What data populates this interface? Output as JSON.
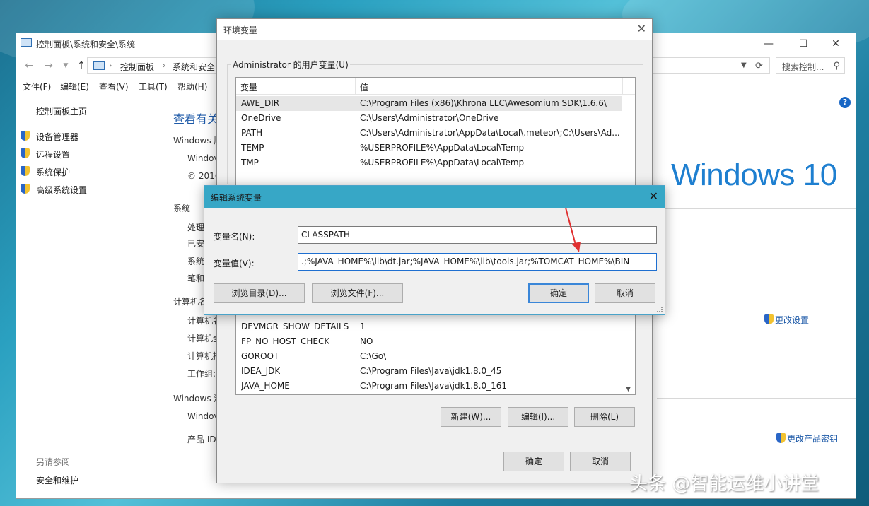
{
  "control_panel": {
    "title": "控制面板\\系统和安全\\系统",
    "breadcrumbs": [
      "控制面板",
      "系统和安全"
    ],
    "search_placeholder": "搜索控制...",
    "menu": [
      "文件(F)",
      "编辑(E)",
      "查看(V)",
      "工具(T)",
      "帮助(H)"
    ],
    "left_home": "控制面板主页",
    "left_links": [
      "设备管理器",
      "远程设置",
      "系统保护",
      "高级系统设置"
    ],
    "see_also": "另请参阅",
    "see_also_link": "安全和维护",
    "heading": "查看有关",
    "sections": {
      "windows_edition": "Windows 版",
      "edition_lines": [
        "Windov",
        "© 2016"
      ],
      "system": "系统",
      "system_lines": [
        "处理",
        "已安",
        "系统",
        "笔和"
      ],
      "computer": "计算机名",
      "computer_lines": [
        "计算机名",
        "计算机全",
        "计算机描",
        "工作组:"
      ],
      "activation": "Windows 激",
      "activation_lines": [
        "Windov",
        "产品 ID:"
      ]
    },
    "logo": "Windows 10",
    "change_settings": "更改设置",
    "change_key": "更改产品密钥"
  },
  "env_dialog": {
    "title": "环境变量",
    "user_group_label": "Administrator 的用户变量(U)",
    "col_var": "变量",
    "col_val": "值",
    "user_vars": [
      {
        "name": "AWE_DIR",
        "value": "C:\\Program Files (x86)\\Khrona LLC\\Awesomium SDK\\1.6.6\\"
      },
      {
        "name": "OneDrive",
        "value": "C:\\Users\\Administrator\\OneDrive"
      },
      {
        "name": "PATH",
        "value": "C:\\Users\\Administrator\\AppData\\Local\\.meteor\\;C:\\Users\\Ad..."
      },
      {
        "name": "TEMP",
        "value": "%USERPROFILE%\\AppData\\Local\\Temp"
      },
      {
        "name": "TMP",
        "value": "%USERPROFILE%\\AppData\\Local\\Temp"
      }
    ],
    "system_vars": [
      {
        "name": "DEVMGR_SHOW_DETAILS",
        "value": "1"
      },
      {
        "name": "FP_NO_HOST_CHECK",
        "value": "NO"
      },
      {
        "name": "GOROOT",
        "value": "C:\\Go\\"
      },
      {
        "name": "IDEA_JDK",
        "value": "C:\\Program Files\\Java\\jdk1.8.0_45"
      },
      {
        "name": "JAVA_HOME",
        "value": "C:\\Program Files\\Java\\jdk1.8.0_161"
      }
    ],
    "btn_new": "新建(W)...",
    "btn_edit": "编辑(I)...",
    "btn_delete": "删除(L)",
    "btn_ok": "确定",
    "btn_cancel": "取消"
  },
  "edit_dialog": {
    "title": "编辑系统变量",
    "name_label": "变量名(N):",
    "name_value": "CLASSPATH",
    "value_label": "变量值(V):",
    "value_value": ".;%JAVA_HOME%\\lib\\dt.jar;%JAVA_HOME%\\lib\\tools.jar;%TOMCAT_HOME%\\BIN",
    "btn_browse_dir": "浏览目录(D)...",
    "btn_browse_file": "浏览文件(F)...",
    "btn_ok": "确定",
    "btn_cancel": "取消"
  },
  "watermark": "头条 @智能运维小讲堂",
  "colors": {
    "accent": "#37a7c6",
    "link": "#1e5aa8",
    "windows_logo": "#1e7fd0",
    "arrow": "#e03030"
  }
}
